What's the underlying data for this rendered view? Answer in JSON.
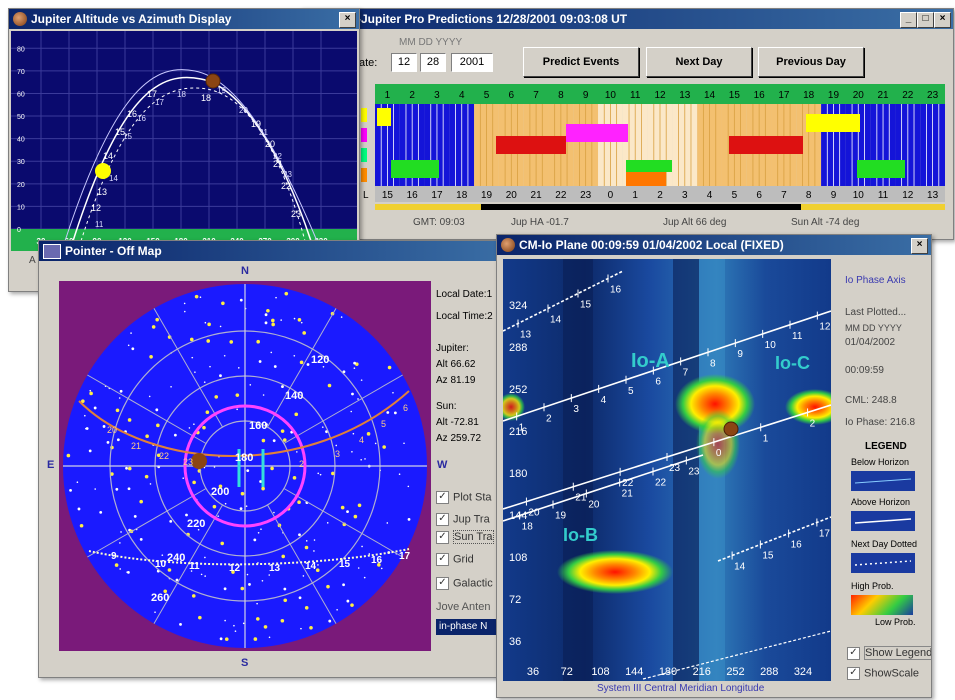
{
  "predictions": {
    "title": "-Jupiter Pro Predictions  12/28/2001  09:03:08 UT",
    "date_hint": "MM  DD  YYYY",
    "date_label": "ate:",
    "month": "12",
    "day": "28",
    "year": "2001",
    "predict_btn": "Predict Events",
    "next_btn": "Next Day",
    "prev_btn": "Previous Day",
    "hours_top": [
      "1",
      "2",
      "3",
      "4",
      "5",
      "6",
      "7",
      "8",
      "9",
      "10",
      "11",
      "12",
      "13",
      "14",
      "15",
      "16",
      "17",
      "18",
      "19",
      "20",
      "21",
      "22",
      "23"
    ],
    "hours_bottom": [
      "15",
      "16",
      "17",
      "18",
      "19",
      "20",
      "21",
      "22",
      "23",
      "0",
      "1",
      "2",
      "3",
      "4",
      "5",
      "6",
      "7",
      "8",
      "9",
      "10",
      "11",
      "12",
      "13"
    ],
    "row_marker": "L",
    "gmt": "GMT: 09:03",
    "jup_ha": "Jup HA -01.7",
    "jup_alt": "Jup Alt 66 deg",
    "sun_alt": "Sun Alt -74 deg"
  },
  "altaz": {
    "title": "Jupiter Altitude vs Azimuth Display",
    "y_ticks": [
      "0",
      "10",
      "20",
      "30",
      "40",
      "50",
      "60",
      "70",
      "80"
    ],
    "x_ticks": [
      "30",
      "60",
      "90",
      "120",
      "150",
      "180",
      "210",
      "240",
      "270",
      "300",
      "330"
    ],
    "left_hours": [
      "12",
      "13",
      "14",
      "15",
      "16",
      "17"
    ],
    "right_hours": [
      "18",
      "19",
      "20",
      "21",
      "22",
      "23"
    ],
    "extra_hours": [
      "11",
      "14",
      "15",
      "16",
      "17",
      "18",
      "19",
      "20",
      "21",
      "22",
      "23"
    ],
    "corner": "A"
  },
  "pointer": {
    "title": "Pointer - Off Map",
    "compass_n": "N",
    "compass_s": "S",
    "compass_e": "E",
    "compass_w": "W",
    "local_date": "Local Date:1",
    "local_time": "Local Time:2",
    "jupiter_label": "Jupiter:",
    "jup_alt": "Alt 66.62",
    "jup_az": "Az 81.19",
    "sun_label": "Sun:",
    "sun_alt": "Alt -72.81",
    "sun_az": "Az 259.72",
    "cb_plot": "Plot Sta",
    "cb_jup": "Jup Tra",
    "cb_sun": "Sun Tra",
    "cb_grid": "Grid",
    "cb_gal": "Galactic",
    "jove_label": "Jove Anten",
    "jove_value": "in-phase N",
    "sky_numbers": [
      "120",
      "140",
      "160",
      "180",
      "200",
      "220",
      "240",
      "260"
    ],
    "sun_track": [
      "9",
      "10",
      "11",
      "12",
      "13",
      "14",
      "15",
      "16",
      "17"
    ],
    "jup_track": [
      "20",
      "21",
      "22",
      "23",
      "2",
      "3",
      "4",
      "5",
      "6"
    ]
  },
  "cmio": {
    "title": "CM-Io Plane 00:09:59   01/04/2002 Local (FIXED)",
    "io_a": "Io-A",
    "io_b": "Io-B",
    "io_c": "Io-C",
    "y_ticks": [
      "324",
      "288",
      "252",
      "216",
      "180",
      "144",
      "108",
      "72",
      "36"
    ],
    "x_ticks": [
      "36",
      "72",
      "108",
      "144",
      "180",
      "216",
      "252",
      "288",
      "324"
    ],
    "x_label": "System III Central Meridian Longitude",
    "phase_axis": "Io Phase Axis",
    "last_plotted": "Last Plotted...",
    "date_hint": "MM DD YYYY",
    "date": "01/04/2002",
    "time": "00:09:59",
    "cml": "CML: 248.8",
    "io_phase": "Io Phase: 216.8",
    "legend_title": "LEGEND",
    "below": "Below Horizon",
    "above": "Above Horizon",
    "next_day": "Next Day Dotted",
    "high_prob": "High Prob.",
    "low_prob": "Low Prob.",
    "show_legend": "Show Legend",
    "show_scale": "ShowScale",
    "line_labels_1": [
      "13",
      "14",
      "15",
      "16"
    ],
    "line_labels_2": [
      "1",
      "2",
      "3",
      "4",
      "5",
      "6",
      "7",
      "8",
      "9",
      "10",
      "11",
      "12"
    ],
    "line_labels_3": [
      "20",
      "21",
      "22",
      "23",
      "0",
      "1",
      "2"
    ],
    "line_labels_4": [
      "18",
      "19",
      "20",
      "21",
      "22",
      "23"
    ],
    "line_labels_5": [
      "14",
      "15",
      "16",
      "17"
    ]
  },
  "colors": {
    "title_dark": "#0a246a",
    "title_light": "#3a6ea5",
    "win_face": "#d4d0c8",
    "chart_navy": "#0a0a6e",
    "green": "#22b14c",
    "sky_blue": "#1a1aff",
    "sky_purple": "#7a1a7a"
  }
}
